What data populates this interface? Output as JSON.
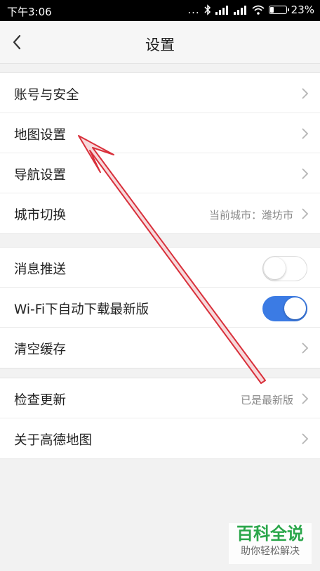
{
  "status_bar": {
    "time": "下午3:06",
    "dots": "...",
    "battery_percent": "23%",
    "battery_level": 0.23
  },
  "header": {
    "title": "设置",
    "back_icon": "chevron-left-icon"
  },
  "groups": [
    {
      "rows": [
        {
          "label": "账号与安全",
          "value": "",
          "control": "chevron"
        },
        {
          "label": "地图设置",
          "value": "",
          "control": "chevron"
        },
        {
          "label": "导航设置",
          "value": "",
          "control": "chevron"
        },
        {
          "label": "城市切换",
          "value": "当前城市：潍坊市",
          "control": "chevron"
        }
      ]
    },
    {
      "rows": [
        {
          "label": "消息推送",
          "control": "toggle",
          "on": false
        },
        {
          "label": "Wi-Fi下自动下载最新版",
          "control": "toggle",
          "on": true
        },
        {
          "label": "清空缓存",
          "value": "",
          "control": "chevron"
        }
      ]
    },
    {
      "rows": [
        {
          "label": "检查更新",
          "value": "已是最新版",
          "control": "chevron"
        },
        {
          "label": "关于高德地图",
          "value": "",
          "control": "chevron"
        }
      ]
    }
  ],
  "colors": {
    "toggle_on": "#3b7be4",
    "annotation_arrow": "#d9303b",
    "watermark_green": "#2aa64a"
  },
  "watermark": {
    "title": "百科全说",
    "subtitle": "助你轻松解决"
  }
}
